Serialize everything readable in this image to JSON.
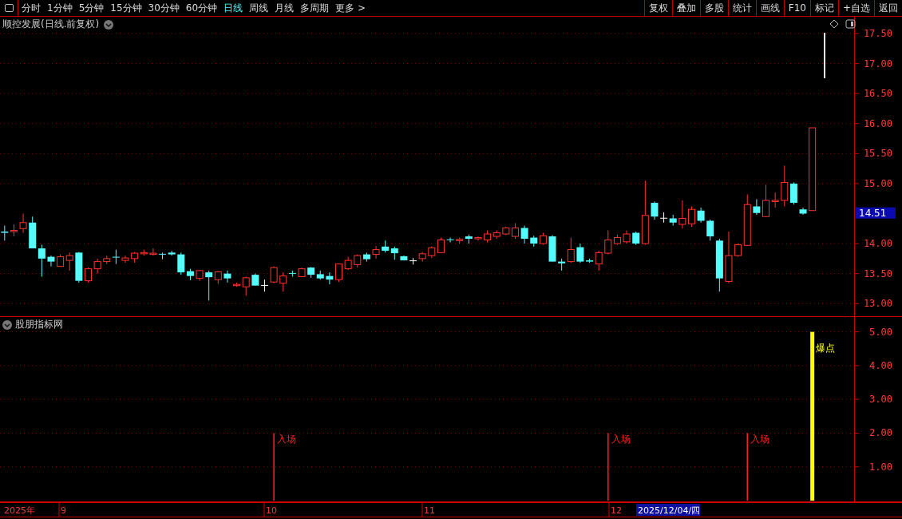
{
  "toolbar": {
    "tabs": [
      {
        "label": "分时",
        "selected": false
      },
      {
        "label": "1分钟",
        "selected": false
      },
      {
        "label": "5分钟",
        "selected": false
      },
      {
        "label": "15分钟",
        "selected": false
      },
      {
        "label": "30分钟",
        "selected": false
      },
      {
        "label": "60分钟",
        "selected": false
      },
      {
        "label": "日线",
        "selected": true
      },
      {
        "label": "周线",
        "selected": false
      },
      {
        "label": "月线",
        "selected": false
      },
      {
        "label": "多周期",
        "selected": false
      },
      {
        "label": "更多 >",
        "selected": false
      }
    ],
    "buttons": [
      "复权",
      "叠加",
      "多股",
      "统计",
      "画线",
      "F10",
      "标记",
      "+自选",
      "返回"
    ]
  },
  "main_panel": {
    "title": "顺控发展(日线.前复权)",
    "last_price": "14.51",
    "year_label": "2025年",
    "month_labels": [
      "9",
      "10",
      "11",
      "12"
    ],
    "date_cursor": "2025/12/04/四",
    "chart_data": {
      "type": "candlestick",
      "ylim": [
        12.79,
        17.78
      ],
      "yticks": [
        {
          "value": 13,
          "label": "13.00"
        },
        {
          "value": 13.5,
          "label": "13.50"
        },
        {
          "value": 14,
          "label": "14.00"
        },
        {
          "value": 15,
          "label": "15.00"
        },
        {
          "value": 15.5,
          "label": "15.50"
        },
        {
          "value": 16,
          "label": "16.00"
        },
        {
          "value": 16.5,
          "label": "16.50"
        },
        {
          "value": 17,
          "label": "17.00"
        },
        {
          "value": 17.5,
          "label": "17.50"
        }
      ],
      "categories": [
        null,
        null,
        null,
        null,
        null,
        null,
        null,
        null,
        null,
        null,
        null,
        null,
        null,
        null,
        null,
        null,
        null,
        null,
        null,
        null,
        null,
        null,
        null,
        null,
        null,
        null,
        null,
        null,
        null,
        null,
        null,
        null,
        null,
        null,
        null,
        null,
        null,
        null,
        null,
        null,
        null,
        null,
        null,
        null,
        null,
        null,
        null,
        null,
        null,
        null,
        null,
        null,
        null,
        null,
        null,
        null,
        null,
        null,
        null,
        null,
        null,
        null,
        null,
        null,
        null,
        null,
        null,
        null,
        null,
        null,
        null,
        null,
        null,
        null,
        null,
        null,
        null,
        null,
        null,
        null,
        null,
        null,
        null,
        null,
        null,
        null,
        null,
        null,
        null,
        null,
        null,
        null
      ],
      "grid": true,
      "ohlc": [
        [
          14.2,
          14.3,
          14.05,
          14.18
        ],
        [
          14.2,
          14.32,
          14.12,
          14.22
        ],
        [
          14.25,
          14.5,
          14.18,
          14.35
        ],
        [
          14.35,
          14.45,
          13.92,
          13.92
        ],
        [
          13.92,
          13.98,
          13.45,
          13.75
        ],
        [
          13.78,
          13.8,
          13.62,
          13.7
        ],
        [
          13.62,
          13.82,
          13.62,
          13.78
        ],
        [
          13.72,
          13.85,
          13.55,
          13.8
        ],
        [
          13.85,
          13.86,
          13.35,
          13.38
        ],
        [
          13.38,
          13.6,
          13.35,
          13.58
        ],
        [
          13.58,
          13.75,
          13.5,
          13.7
        ],
        [
          13.7,
          13.8,
          13.66,
          13.75
        ],
        [
          13.78,
          13.9,
          13.66,
          13.77
        ],
        [
          13.72,
          13.8,
          13.68,
          13.76
        ],
        [
          13.75,
          13.86,
          13.68,
          13.84
        ],
        [
          13.83,
          13.9,
          13.8,
          13.85
        ],
        [
          13.82,
          13.92,
          13.8,
          13.84
        ],
        [
          13.83,
          13.85,
          13.74,
          13.82
        ],
        [
          13.85,
          13.88,
          13.8,
          13.82
        ],
        [
          13.82,
          13.85,
          13.48,
          13.52
        ],
        [
          13.54,
          13.58,
          13.39,
          13.46
        ],
        [
          13.42,
          13.56,
          13.38,
          13.55
        ],
        [
          13.52,
          13.55,
          13.05,
          13.44
        ],
        [
          13.4,
          13.54,
          13.33,
          13.53
        ],
        [
          13.5,
          13.55,
          13.35,
          13.42
        ],
        [
          13.3,
          13.35,
          13.28,
          13.32
        ],
        [
          13.28,
          13.45,
          13.13,
          13.43
        ],
        [
          13.48,
          13.5,
          13.3,
          13.3
        ],
        [
          13.31,
          13.4,
          13.2,
          13.31
        ],
        [
          13.36,
          13.62,
          13.34,
          13.6
        ],
        [
          13.34,
          13.52,
          13.2,
          13.46
        ],
        [
          13.51,
          13.55,
          13.45,
          13.5
        ],
        [
          13.45,
          13.6,
          13.44,
          13.58
        ],
        [
          13.6,
          13.61,
          13.43,
          13.48
        ],
        [
          13.49,
          13.55,
          13.4,
          13.42
        ],
        [
          13.46,
          13.52,
          13.32,
          13.4
        ],
        [
          13.4,
          13.67,
          13.36,
          13.66
        ],
        [
          13.58,
          13.78,
          13.56,
          13.72
        ],
        [
          13.65,
          13.82,
          13.6,
          13.8
        ],
        [
          13.82,
          13.85,
          13.7,
          13.74
        ],
        [
          13.82,
          13.96,
          13.75,
          13.9
        ],
        [
          13.95,
          14.05,
          13.85,
          13.88
        ],
        [
          13.92,
          13.95,
          13.73,
          13.84
        ],
        [
          13.79,
          13.8,
          13.72,
          13.72
        ],
        [
          13.72,
          13.76,
          13.65,
          13.72
        ],
        [
          13.75,
          13.86,
          13.7,
          13.83
        ],
        [
          13.8,
          13.95,
          13.76,
          13.93
        ],
        [
          13.85,
          14.1,
          13.85,
          14.06
        ],
        [
          14.07,
          14.1,
          14.02,
          14.06
        ],
        [
          14.05,
          14.1,
          14.0,
          14.07
        ],
        [
          14.12,
          14.15,
          14.0,
          14.08
        ],
        [
          14.08,
          14.12,
          14.05,
          14.1
        ],
        [
          14.06,
          14.22,
          14.02,
          14.16
        ],
        [
          14.12,
          14.22,
          14.08,
          14.18
        ],
        [
          14.16,
          14.28,
          14.14,
          14.26
        ],
        [
          14.12,
          14.34,
          14.08,
          14.26
        ],
        [
          14.26,
          14.3,
          14.0,
          14.08
        ],
        [
          14.1,
          14.13,
          13.95,
          14.0
        ],
        [
          14.0,
          14.18,
          13.98,
          14.13
        ],
        [
          14.12,
          14.14,
          13.7,
          13.7
        ],
        [
          13.7,
          13.75,
          13.55,
          13.67
        ],
        [
          13.7,
          14.1,
          13.68,
          13.9
        ],
        [
          13.94,
          14.0,
          13.68,
          13.7
        ],
        [
          13.72,
          13.75,
          13.68,
          13.7
        ],
        [
          13.66,
          13.88,
          13.55,
          13.85
        ],
        [
          13.84,
          14.22,
          13.82,
          14.06
        ],
        [
          14.0,
          14.15,
          13.98,
          14.1
        ],
        [
          14.03,
          14.22,
          14.0,
          14.16
        ],
        [
          14.18,
          14.2,
          13.98,
          14.0
        ],
        [
          14.0,
          15.05,
          13.98,
          14.47
        ],
        [
          14.68,
          14.7,
          14.4,
          14.45
        ],
        [
          14.43,
          14.52,
          14.35,
          14.43
        ],
        [
          14.42,
          14.48,
          14.3,
          14.35
        ],
        [
          14.32,
          14.72,
          14.25,
          14.42
        ],
        [
          14.33,
          14.62,
          14.28,
          14.57
        ],
        [
          14.55,
          14.6,
          14.35,
          14.38
        ],
        [
          14.38,
          14.4,
          14.05,
          14.12
        ],
        [
          14.05,
          14.08,
          13.2,
          13.42
        ],
        [
          13.37,
          14.2,
          13.34,
          13.8
        ],
        [
          13.8,
          14.0,
          13.78,
          13.98
        ],
        [
          13.97,
          14.82,
          13.97,
          14.65
        ],
        [
          14.62,
          14.74,
          14.48,
          14.51
        ],
        [
          14.45,
          14.98,
          14.45,
          14.72
        ],
        [
          14.7,
          14.85,
          14.6,
          14.72
        ],
        [
          14.72,
          15.3,
          14.62,
          15.02
        ],
        [
          15.0,
          15.02,
          14.65,
          14.68
        ],
        [
          14.57,
          14.6,
          14.48,
          14.5
        ],
        [
          14.55,
          15.93,
          14.55,
          15.93
        ],
        null,
        null,
        null,
        null
      ]
    }
  },
  "indicator_panel": {
    "title": "股朋指标网",
    "chart_data": {
      "type": "bar",
      "ylim": [
        0,
        5.44
      ],
      "categories": [
        null,
        null,
        null,
        null,
        null,
        null,
        null,
        null,
        null,
        null,
        null,
        null,
        null,
        null,
        null,
        null,
        null,
        null,
        null,
        null,
        null,
        null,
        null,
        null,
        null,
        null,
        null,
        null,
        null,
        null,
        null,
        null,
        null,
        null,
        null,
        null,
        null,
        null,
        null,
        null,
        null,
        null,
        null,
        null,
        null,
        null,
        null,
        null,
        null,
        null,
        null,
        null,
        null,
        null,
        null,
        null,
        null,
        null,
        null,
        null,
        null,
        null,
        null,
        null,
        null,
        null,
        null,
        null,
        null,
        null,
        null,
        null,
        null,
        null,
        null,
        null,
        null,
        null,
        null,
        null,
        null,
        null,
        null,
        null,
        null,
        null,
        null,
        null,
        null,
        null,
        null,
        null
      ],
      "grid": true,
      "yticks": [
        {
          "value": 1,
          "label": "1.00"
        },
        {
          "value": 2,
          "label": "2.00"
        },
        {
          "value": 3,
          "label": "3.00"
        },
        {
          "value": 4,
          "label": "4.00"
        },
        {
          "value": 5,
          "label": "5.00"
        }
      ],
      "series": [
        {
          "name": "入场",
          "color": "#ff2020",
          "values": [
            null,
            null,
            null,
            null,
            null,
            null,
            null,
            null,
            null,
            null,
            null,
            null,
            null,
            null,
            null,
            null,
            null,
            null,
            null,
            null,
            null,
            null,
            null,
            null,
            null,
            null,
            null,
            null,
            null,
            2,
            null,
            null,
            null,
            null,
            null,
            null,
            null,
            null,
            null,
            null,
            null,
            null,
            null,
            null,
            null,
            null,
            null,
            null,
            null,
            null,
            null,
            null,
            null,
            null,
            null,
            null,
            null,
            null,
            null,
            null,
            null,
            null,
            null,
            null,
            null,
            2,
            null,
            null,
            null,
            null,
            null,
            null,
            null,
            null,
            null,
            null,
            null,
            null,
            null,
            null,
            2,
            null,
            null,
            null,
            null,
            null,
            null,
            null,
            null,
            null,
            null,
            null
          ]
        },
        {
          "name": "爆点",
          "color": "#ffff00",
          "values": [
            null,
            null,
            null,
            null,
            null,
            null,
            null,
            null,
            null,
            null,
            null,
            null,
            null,
            null,
            null,
            null,
            null,
            null,
            null,
            null,
            null,
            null,
            null,
            null,
            null,
            null,
            null,
            null,
            null,
            null,
            null,
            null,
            null,
            null,
            null,
            null,
            null,
            null,
            null,
            null,
            null,
            null,
            null,
            null,
            null,
            null,
            null,
            null,
            null,
            null,
            null,
            null,
            null,
            null,
            null,
            null,
            null,
            null,
            null,
            null,
            null,
            null,
            null,
            null,
            null,
            null,
            null,
            null,
            null,
            null,
            null,
            null,
            null,
            null,
            null,
            null,
            null,
            null,
            null,
            null,
            null,
            null,
            null,
            null,
            null,
            null,
            null,
            5,
            null,
            null,
            null,
            null
          ]
        }
      ]
    }
  }
}
